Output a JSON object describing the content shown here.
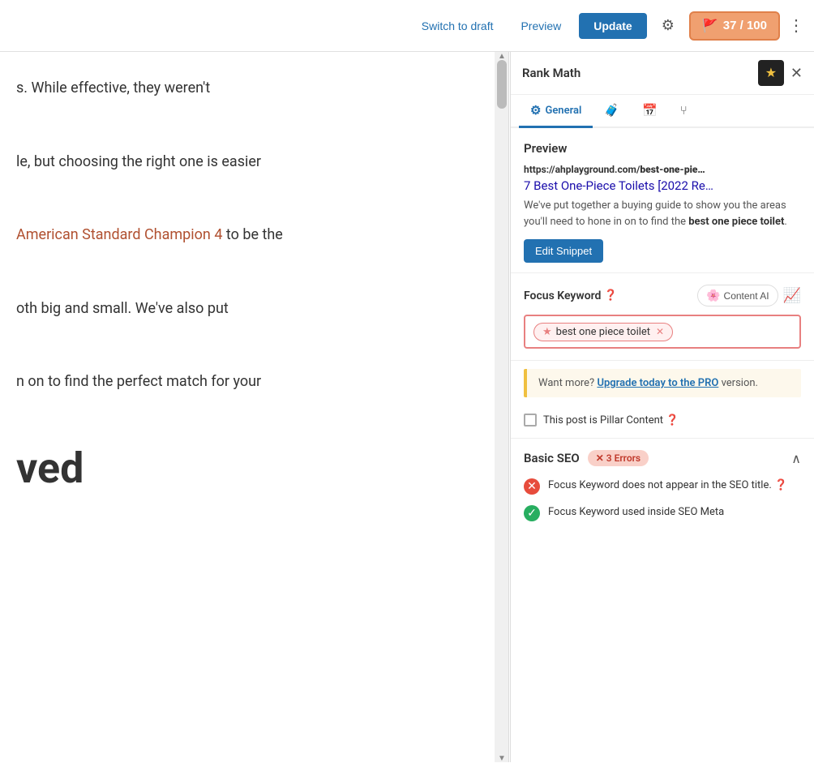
{
  "toolbar": {
    "switch_to_draft_label": "Switch to draft",
    "preview_label": "Preview",
    "update_label": "Update",
    "score_label": "37 / 100",
    "more_label": "⋮"
  },
  "main_content": {
    "line1": "s. While effective, they weren't",
    "line2": "le, but choosing the right one is easier",
    "link_text": "American Standard Champion 4",
    "line3_pre": "",
    "line3_post": " to be the",
    "line4": "oth big and small. We've also put",
    "line5": "n on to find the perfect match for your",
    "big_text": "ved"
  },
  "sidebar": {
    "title": "Rank Math",
    "tabs": [
      {
        "label": "General",
        "icon": "⚙",
        "active": true
      },
      {
        "label": "",
        "icon": "🧳",
        "active": false
      },
      {
        "label": "",
        "icon": "📅",
        "active": false
      },
      {
        "label": "",
        "icon": "⑂",
        "active": false
      }
    ],
    "preview": {
      "section_label": "Preview",
      "url": "https://ahplayground.com/best-one-pie…",
      "url_bold": "best-one-pie…",
      "title": "7 Best One-Piece Toilets [2022 Re…",
      "description_plain": "We've put together a buying guide to show you the areas you'll need to hone in on to find the",
      "description_bold": "best one piece toilet",
      "description_end": ".",
      "edit_snippet_label": "Edit Snippet"
    },
    "focus_keyword": {
      "label": "Focus Keyword",
      "content_ai_label": "Content AI",
      "keyword": "best one piece toilet"
    },
    "upgrade_notice": {
      "text_before": "Want more?",
      "link_text": "Upgrade today to the PRO",
      "text_after": "version."
    },
    "pillar": {
      "label": "This post is Pillar Content"
    },
    "basic_seo": {
      "label": "Basic SEO",
      "error_badge": "✕ 3 Errors",
      "items": [
        {
          "type": "error",
          "text": "Focus Keyword does not appear in the SEO title."
        },
        {
          "type": "success",
          "text": "Focus Keyword used inside SEO Meta"
        }
      ]
    }
  }
}
